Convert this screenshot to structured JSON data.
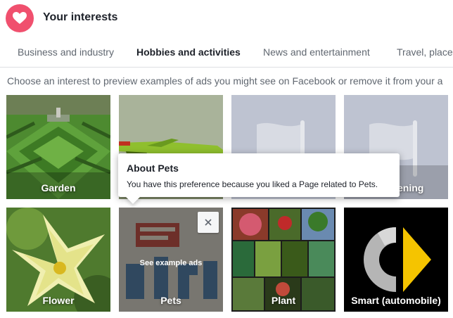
{
  "header": {
    "title": "Your interests",
    "icon": "heart-icon",
    "accent": "#f0506e"
  },
  "tabs": [
    {
      "label": "Business and industry",
      "active": false
    },
    {
      "label": "Hobbies and activities",
      "active": true
    },
    {
      "label": "News and entertainment",
      "active": false
    },
    {
      "label": "Travel, place",
      "active": false
    }
  ],
  "instruction": "Choose an interest to preview examples of ads you might see on Facebook or remove it from your a",
  "tooltip": {
    "title": "About Pets",
    "body": "You have this preference because you liked a Page related to Pets."
  },
  "tiles": [
    {
      "label": "Garden"
    },
    {
      "label": ""
    },
    {
      "label": ""
    },
    {
      "label": "ening"
    },
    {
      "label": "Flower"
    },
    {
      "label": "Pets",
      "hover_text": "See example ads"
    },
    {
      "label": "Plant"
    },
    {
      "label": "Smart (automobile)"
    }
  ]
}
